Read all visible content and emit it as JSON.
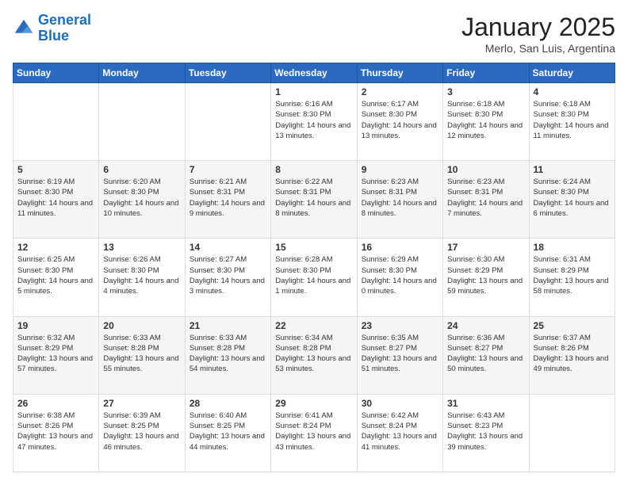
{
  "header": {
    "logo_line1": "General",
    "logo_line2": "Blue",
    "title": "January 2025",
    "subtitle": "Merlo, San Luis, Argentina"
  },
  "days_of_week": [
    "Sunday",
    "Monday",
    "Tuesday",
    "Wednesday",
    "Thursday",
    "Friday",
    "Saturday"
  ],
  "weeks": [
    [
      {
        "num": "",
        "sunrise": "",
        "sunset": "",
        "daylight": ""
      },
      {
        "num": "",
        "sunrise": "",
        "sunset": "",
        "daylight": ""
      },
      {
        "num": "",
        "sunrise": "",
        "sunset": "",
        "daylight": ""
      },
      {
        "num": "1",
        "sunrise": "Sunrise: 6:16 AM",
        "sunset": "Sunset: 8:30 PM",
        "daylight": "Daylight: 14 hours and 13 minutes."
      },
      {
        "num": "2",
        "sunrise": "Sunrise: 6:17 AM",
        "sunset": "Sunset: 8:30 PM",
        "daylight": "Daylight: 14 hours and 13 minutes."
      },
      {
        "num": "3",
        "sunrise": "Sunrise: 6:18 AM",
        "sunset": "Sunset: 8:30 PM",
        "daylight": "Daylight: 14 hours and 12 minutes."
      },
      {
        "num": "4",
        "sunrise": "Sunrise: 6:18 AM",
        "sunset": "Sunset: 8:30 PM",
        "daylight": "Daylight: 14 hours and 11 minutes."
      }
    ],
    [
      {
        "num": "5",
        "sunrise": "Sunrise: 6:19 AM",
        "sunset": "Sunset: 8:30 PM",
        "daylight": "Daylight: 14 hours and 11 minutes."
      },
      {
        "num": "6",
        "sunrise": "Sunrise: 6:20 AM",
        "sunset": "Sunset: 8:30 PM",
        "daylight": "Daylight: 14 hours and 10 minutes."
      },
      {
        "num": "7",
        "sunrise": "Sunrise: 6:21 AM",
        "sunset": "Sunset: 8:31 PM",
        "daylight": "Daylight: 14 hours and 9 minutes."
      },
      {
        "num": "8",
        "sunrise": "Sunrise: 6:22 AM",
        "sunset": "Sunset: 8:31 PM",
        "daylight": "Daylight: 14 hours and 8 minutes."
      },
      {
        "num": "9",
        "sunrise": "Sunrise: 6:23 AM",
        "sunset": "Sunset: 8:31 PM",
        "daylight": "Daylight: 14 hours and 8 minutes."
      },
      {
        "num": "10",
        "sunrise": "Sunrise: 6:23 AM",
        "sunset": "Sunset: 8:31 PM",
        "daylight": "Daylight: 14 hours and 7 minutes."
      },
      {
        "num": "11",
        "sunrise": "Sunrise: 6:24 AM",
        "sunset": "Sunset: 8:30 PM",
        "daylight": "Daylight: 14 hours and 6 minutes."
      }
    ],
    [
      {
        "num": "12",
        "sunrise": "Sunrise: 6:25 AM",
        "sunset": "Sunset: 8:30 PM",
        "daylight": "Daylight: 14 hours and 5 minutes."
      },
      {
        "num": "13",
        "sunrise": "Sunrise: 6:26 AM",
        "sunset": "Sunset: 8:30 PM",
        "daylight": "Daylight: 14 hours and 4 minutes."
      },
      {
        "num": "14",
        "sunrise": "Sunrise: 6:27 AM",
        "sunset": "Sunset: 8:30 PM",
        "daylight": "Daylight: 14 hours and 3 minutes."
      },
      {
        "num": "15",
        "sunrise": "Sunrise: 6:28 AM",
        "sunset": "Sunset: 8:30 PM",
        "daylight": "Daylight: 14 hours and 1 minute."
      },
      {
        "num": "16",
        "sunrise": "Sunrise: 6:29 AM",
        "sunset": "Sunset: 8:30 PM",
        "daylight": "Daylight: 14 hours and 0 minutes."
      },
      {
        "num": "17",
        "sunrise": "Sunrise: 6:30 AM",
        "sunset": "Sunset: 8:29 PM",
        "daylight": "Daylight: 13 hours and 59 minutes."
      },
      {
        "num": "18",
        "sunrise": "Sunrise: 6:31 AM",
        "sunset": "Sunset: 8:29 PM",
        "daylight": "Daylight: 13 hours and 58 minutes."
      }
    ],
    [
      {
        "num": "19",
        "sunrise": "Sunrise: 6:32 AM",
        "sunset": "Sunset: 8:29 PM",
        "daylight": "Daylight: 13 hours and 57 minutes."
      },
      {
        "num": "20",
        "sunrise": "Sunrise: 6:33 AM",
        "sunset": "Sunset: 8:28 PM",
        "daylight": "Daylight: 13 hours and 55 minutes."
      },
      {
        "num": "21",
        "sunrise": "Sunrise: 6:33 AM",
        "sunset": "Sunset: 8:28 PM",
        "daylight": "Daylight: 13 hours and 54 minutes."
      },
      {
        "num": "22",
        "sunrise": "Sunrise: 6:34 AM",
        "sunset": "Sunset: 8:28 PM",
        "daylight": "Daylight: 13 hours and 53 minutes."
      },
      {
        "num": "23",
        "sunrise": "Sunrise: 6:35 AM",
        "sunset": "Sunset: 8:27 PM",
        "daylight": "Daylight: 13 hours and 51 minutes."
      },
      {
        "num": "24",
        "sunrise": "Sunrise: 6:36 AM",
        "sunset": "Sunset: 8:27 PM",
        "daylight": "Daylight: 13 hours and 50 minutes."
      },
      {
        "num": "25",
        "sunrise": "Sunrise: 6:37 AM",
        "sunset": "Sunset: 8:26 PM",
        "daylight": "Daylight: 13 hours and 49 minutes."
      }
    ],
    [
      {
        "num": "26",
        "sunrise": "Sunrise: 6:38 AM",
        "sunset": "Sunset: 8:26 PM",
        "daylight": "Daylight: 13 hours and 47 minutes."
      },
      {
        "num": "27",
        "sunrise": "Sunrise: 6:39 AM",
        "sunset": "Sunset: 8:25 PM",
        "daylight": "Daylight: 13 hours and 46 minutes."
      },
      {
        "num": "28",
        "sunrise": "Sunrise: 6:40 AM",
        "sunset": "Sunset: 8:25 PM",
        "daylight": "Daylight: 13 hours and 44 minutes."
      },
      {
        "num": "29",
        "sunrise": "Sunrise: 6:41 AM",
        "sunset": "Sunset: 8:24 PM",
        "daylight": "Daylight: 13 hours and 43 minutes."
      },
      {
        "num": "30",
        "sunrise": "Sunrise: 6:42 AM",
        "sunset": "Sunset: 8:24 PM",
        "daylight": "Daylight: 13 hours and 41 minutes."
      },
      {
        "num": "31",
        "sunrise": "Sunrise: 6:43 AM",
        "sunset": "Sunset: 8:23 PM",
        "daylight": "Daylight: 13 hours and 39 minutes."
      },
      {
        "num": "",
        "sunrise": "",
        "sunset": "",
        "daylight": ""
      }
    ]
  ]
}
